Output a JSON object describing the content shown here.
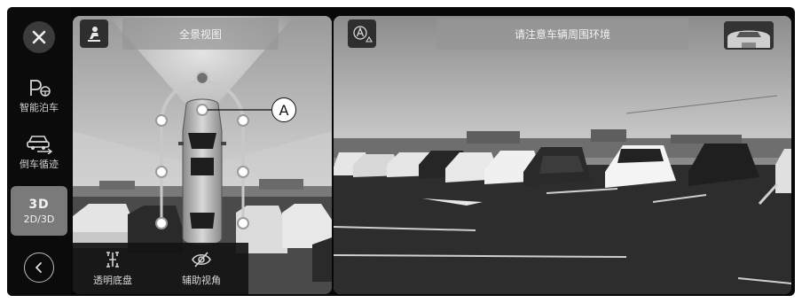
{
  "sidebar": {
    "close_icon": "close-icon",
    "parking": {
      "label": "智能泊车",
      "icon": "parking-icon"
    },
    "reverse": {
      "label": "倒车循迹",
      "icon": "reverse-trace-icon"
    },
    "view_mode": {
      "primary": "3D",
      "secondary": "2D/3D",
      "active": true
    },
    "back_icon": "back-arrow-icon"
  },
  "left_view": {
    "title": "全景视图",
    "person_icon": "driver-view-icon",
    "callout_label": "A",
    "bottom_bar": {
      "items": [
        {
          "label": "透明底盘",
          "icon": "transparent-chassis-icon"
        },
        {
          "label": "辅助视角",
          "icon": "eye-off-icon"
        }
      ]
    }
  },
  "right_view": {
    "title": "请注意车辆周围环境",
    "left_icon": "camera-auto-icon",
    "right_icon": "front-camera-thumbnail-icon"
  },
  "colors": {
    "frame": "#080808",
    "active_button": "#7a7a7a",
    "pill": "#969696"
  }
}
